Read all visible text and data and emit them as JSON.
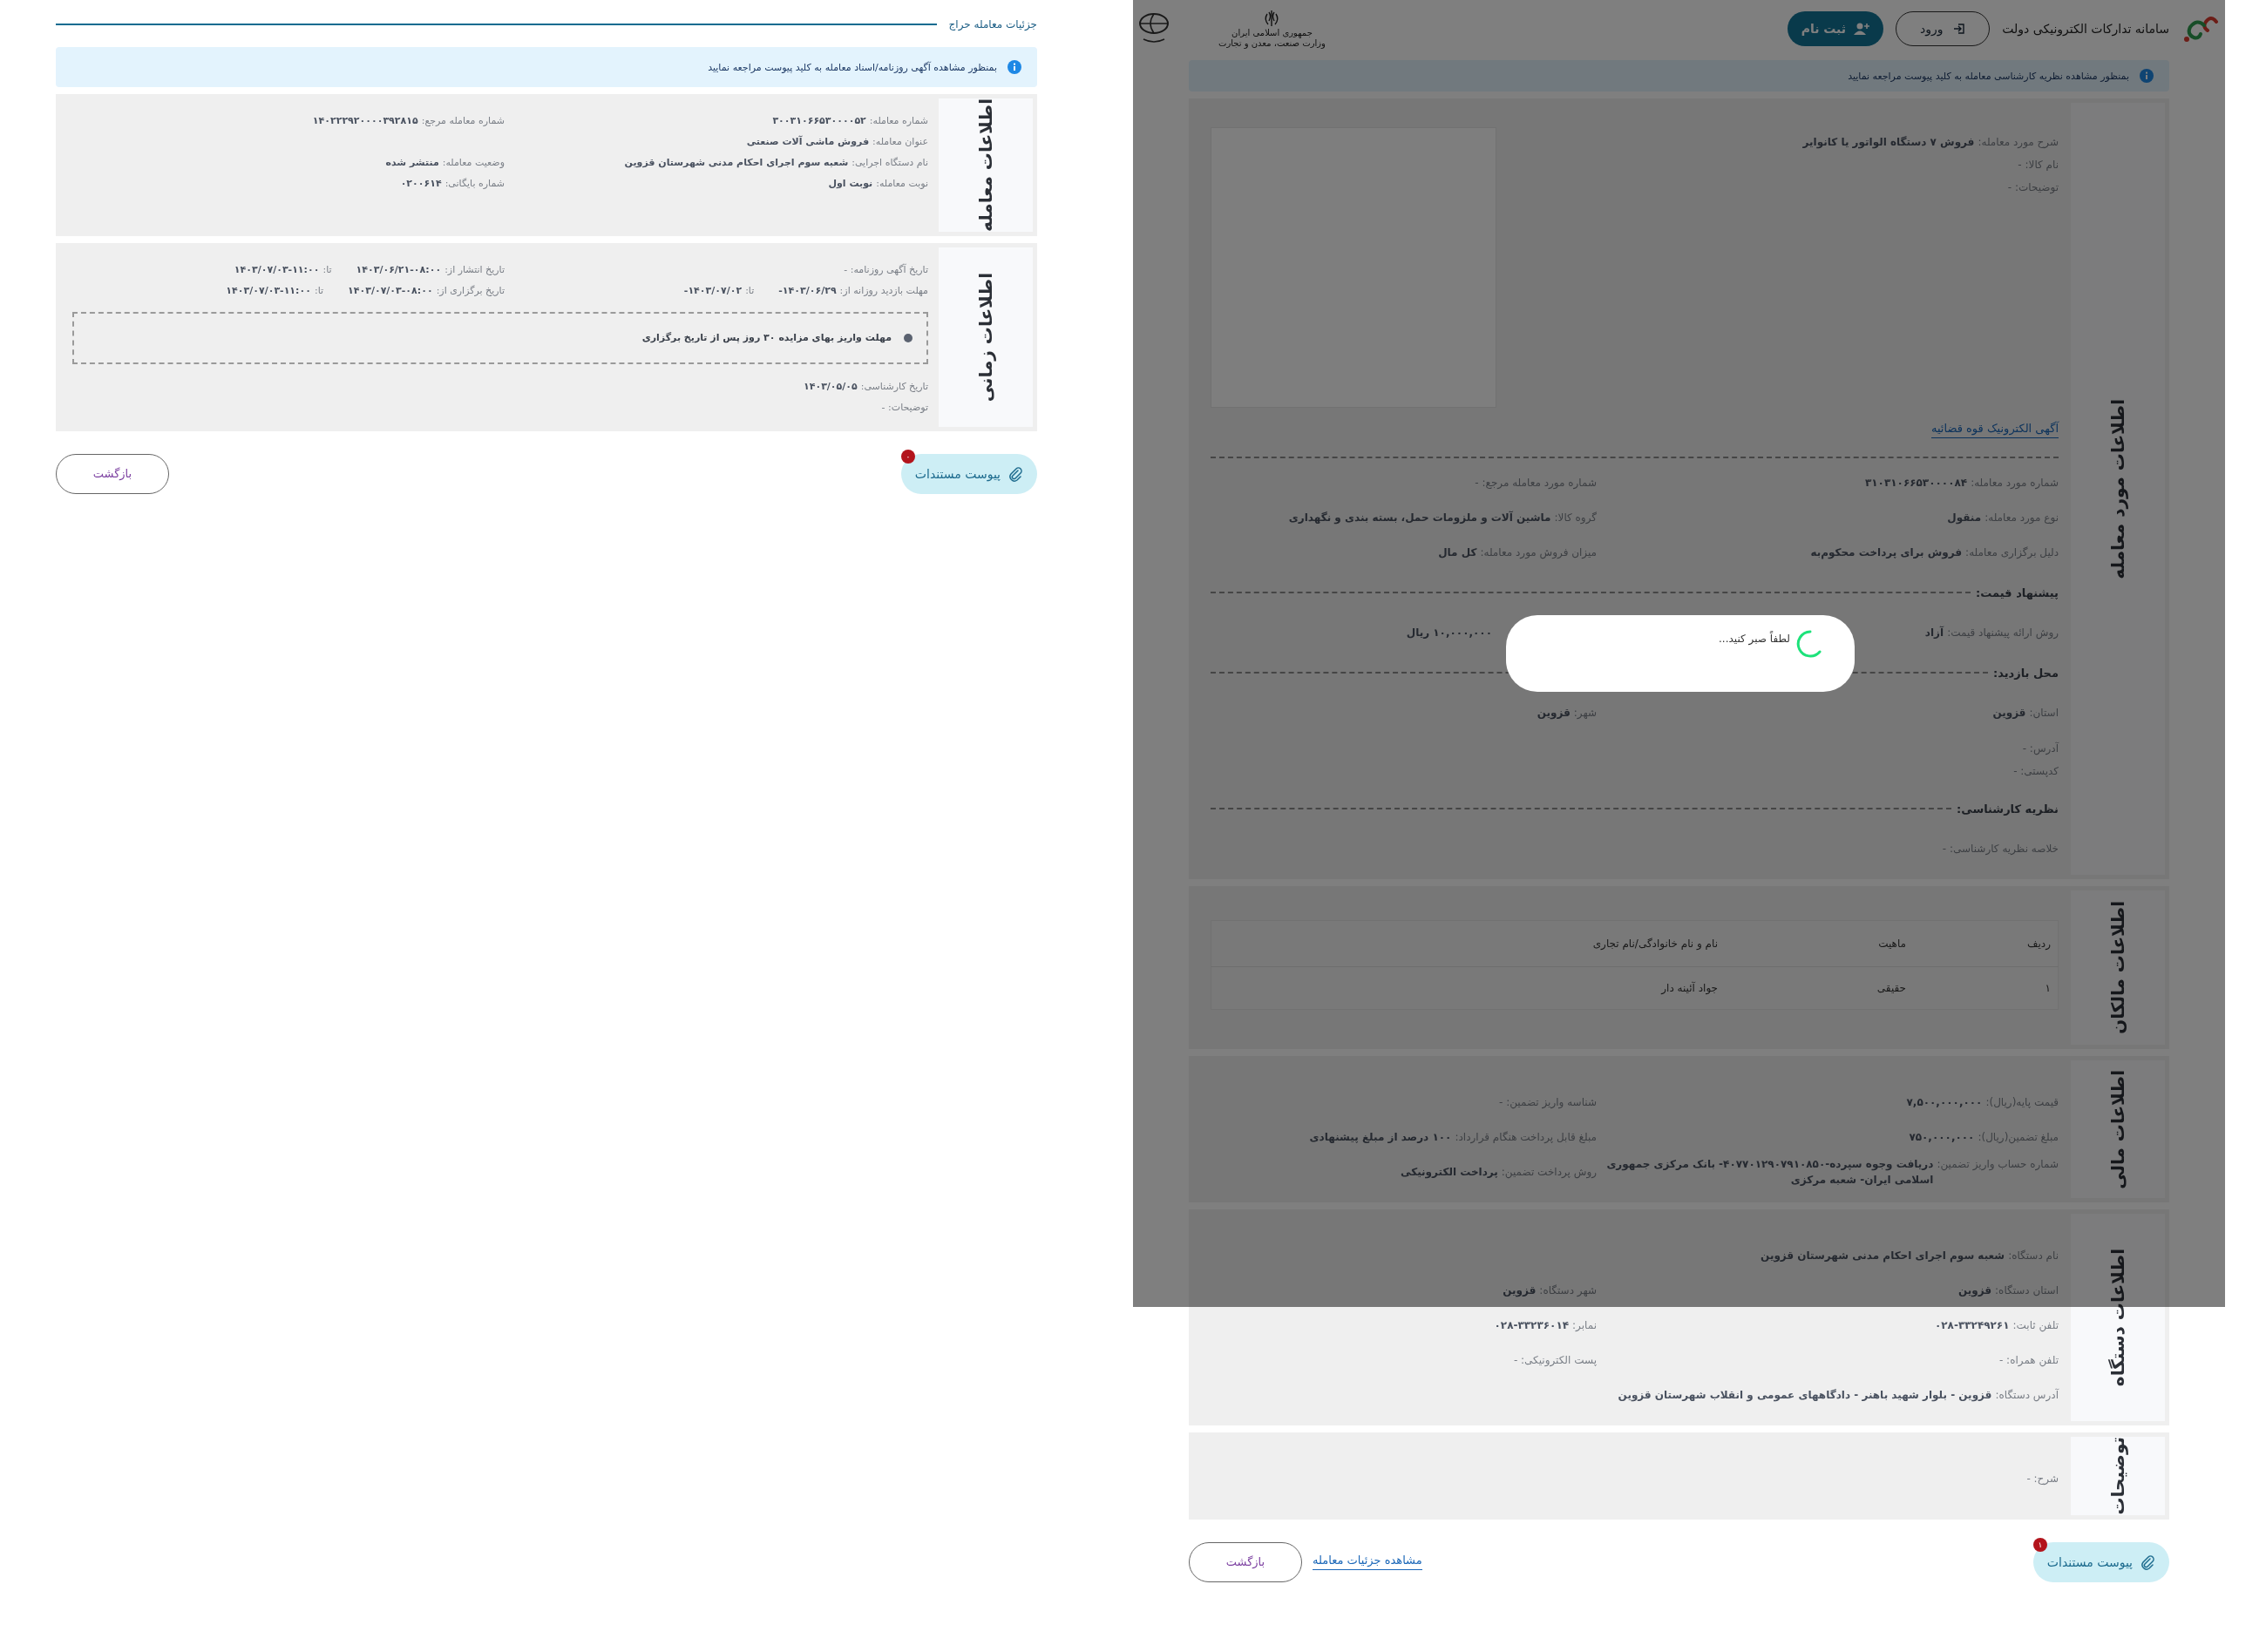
{
  "left_page": {
    "title": "جزئیات معامله حراج",
    "notice": "بمنظور مشاهده آگهی روزنامه/اسناد معامله به کلید پیوست مراجعه نمایید",
    "sections": [
      {
        "title": "اطلاعات معامله",
        "blocks": [
          {
            "kind": "fields",
            "rows": [
              [
                {
                  "label": "شماره معامله:",
                  "value": "۳۰۰۳۱۰۶۶۵۳۰۰۰۰۵۲"
                },
                {
                  "label": "شماره معامله مرجع:",
                  "value": "۱۴۰۲۲۲۹۲۰۰۰۰۳۹۲۸۱۵"
                }
              ],
              [
                {
                  "label": "عنوان معامله:",
                  "value": "فروش ماشی آلات صنعتی"
                }
              ],
              [
                {
                  "label": "نام دستگاه اجرایی:",
                  "value": "شعبه سوم اجرای احکام مدنی شهرستان قزوین"
                },
                {
                  "label": "وضعیت معامله:",
                  "value": "منتشر شده"
                }
              ],
              [
                {
                  "label": "نوبت معامله:",
                  "value": "نوبت اول"
                },
                {
                  "label": "شماره بایگانی:",
                  "value": "۰۲۰۰۶۱۴"
                }
              ]
            ]
          }
        ]
      },
      {
        "title": "اطلاعات زمانی",
        "blocks": [
          {
            "kind": "fields",
            "rows": [
              [
                {
                  "label": "تاریخ آگهی روزنامه: -"
                },
                {
                  "label": "تاریخ انتشار از:",
                  "value": "۱۴۰۳/۰۶/۲۱-۰۸:۰۰",
                  "to_label": "تا:",
                  "to_value": "۱۴۰۳/۰۷/۰۳-۱۱:۰۰"
                }
              ],
              [
                {
                  "label": "مهلت بازدید روزانه از:",
                  "value": "۱۴۰۳/۰۶/۲۹-",
                  "to_label": "تا:",
                  "to_value": "۱۴۰۳/۰۷/۰۲-"
                },
                {
                  "label": "تاریخ برگزاری از:",
                  "value": "۱۴۰۳/۰۷/۰۳-۰۸:۰۰",
                  "to_label": "تا:",
                  "to_value": "۱۴۰۳/۰۷/۰۳-۱۱:۰۰"
                }
              ]
            ]
          },
          {
            "kind": "note",
            "text": "مهلت واریز بهای مزایده ۳۰ روز پس از تاریخ برگزاری"
          },
          {
            "kind": "fields",
            "rows": [
              [
                {
                  "label": "تاریخ کارشناسی:",
                  "value": "۱۴۰۳/۰۵/۰۵"
                }
              ],
              [
                {
                  "label": "توضیحات: -"
                }
              ]
            ]
          }
        ]
      }
    ],
    "actions": {
      "attach": {
        "label": "پیوست مستندات",
        "badge": "۰"
      },
      "back": "بازگشت"
    }
  },
  "right_page": {
    "header": {
      "site_title": "سامانه تدارکات الکترونیکی دولت",
      "login": "ورود",
      "register": "ثبت نام",
      "emblem_lines": [
        "جمهوری اسلامی ایران",
        "وزارت صنعت، معدن و تجارت"
      ]
    },
    "notice": "بمنظور مشاهده نظریه کارشناسی معامله به کلید پیوست مراجعه نمایید",
    "sections": [
      {
        "title": "اطلاعات مورد معامله",
        "blocks": [
          {
            "kind": "media",
            "rows": [
              [
                {
                  "label": "شرح مورد معامله:",
                  "value": "فروش ۷ دستگاه الواتور یا کانوایر"
                }
              ],
              [
                {
                  "label": "نام کالا: -"
                }
              ],
              [
                {
                  "label": "توضیحات: -"
                }
              ]
            ]
          },
          {
            "kind": "link",
            "text": "آگهی الکترونیک قوه قضائیه"
          },
          {
            "kind": "divider"
          },
          {
            "kind": "fields",
            "rows": [
              [
                {
                  "label": "شماره مورد معامله:",
                  "value": "۳۱۰۳۱۰۶۶۵۳۰۰۰۰۸۴"
                },
                {
                  "label": "شماره مورد معامله مرجع: -"
                }
              ],
              [
                {
                  "label": "نوع مورد معامله:",
                  "value": "منقول"
                },
                {
                  "label": "گروه کالا:",
                  "value": "ماشین آلات و ملزومات حمل، بسته بندی و نگهداری"
                }
              ],
              [
                {
                  "label": "دلیل برگزاری معامله:",
                  "value": "فروش برای پرداخت محکوم‌به"
                },
                {
                  "label": "میزان فروش مورد معامله:",
                  "value": "کل مال"
                }
              ]
            ]
          },
          {
            "kind": "heading",
            "text": "پیشنهاد قیمت:"
          },
          {
            "kind": "fields",
            "rows": [
              [
                {
                  "label": "روش ارائه پیشنهاد قیمت:",
                  "value": "آزاد"
                },
                {
                  "value": "۱۰,۰۰۰,۰۰۰ ریال"
                }
              ]
            ]
          },
          {
            "kind": "heading",
            "text": "محل بازدید:"
          },
          {
            "kind": "fields",
            "rows": [
              [
                {
                  "label": "استان:",
                  "value": "قزوین"
                },
                {
                  "label": "شهر:",
                  "value": "قزوین"
                }
              ]
            ]
          },
          {
            "kind": "compact",
            "rows": [
              [
                {
                  "label": "آدرس: -"
                }
              ],
              [
                {
                  "label": "کدپستی: -"
                }
              ]
            ]
          },
          {
            "kind": "heading",
            "text": "نظریه کارشناسی:"
          },
          {
            "kind": "fields",
            "rows": [
              [
                {
                  "label": "خلاصه نظریه کارشناسی: -"
                }
              ]
            ]
          }
        ]
      },
      {
        "title": "اطلاعات مالکان",
        "blocks": [
          {
            "kind": "table",
            "columns": [
              "ردیف",
              "ماهیت",
              "نام و نام خانوادگی/نام تجاری"
            ],
            "rows": [
              [
                "۱",
                "حقیقی",
                "جواد آئینه دار"
              ]
            ]
          }
        ]
      },
      {
        "title": "اطلاعات مالی",
        "blocks": [
          {
            "kind": "fields",
            "rows": [
              [
                {
                  "label": "قیمت پایه(ریال):",
                  "value": "۷,۵۰۰,۰۰۰,۰۰۰"
                },
                {
                  "label": "شناسه واریز تضمین: -"
                }
              ],
              [
                {
                  "label": "مبلغ تضمین(ریال):",
                  "value": "۷۵۰,۰۰۰,۰۰۰"
                },
                {
                  "label": "مبلغ قابل پرداخت هنگام قرارداد:",
                  "value": "۱۰۰ درصد از مبلغ پیشنهادی"
                }
              ],
              [
                {
                  "label": "شماره حساب واریز تضمین:",
                  "value": "دریافت وجوه سپرده-۴۰۷۷۰۱۲۹۰۷۹۱۰۸۵۰- بانک مرکزی جمهوری اسلامی ایران- شعبه مرکزی"
                },
                {
                  "label": "روش پرداخت تضمین:",
                  "value": "پرداخت الکترونیکی"
                }
              ]
            ]
          }
        ]
      },
      {
        "title": "اطلاعات دستگاه",
        "blocks": [
          {
            "kind": "fields",
            "rows": [
              [
                {
                  "label": "نام دستگاه:",
                  "value": "شعبه سوم اجرای احکام مدنی شهرستان قزوین"
                }
              ],
              [
                {
                  "label": "استان دستگاه:",
                  "value": "قزوین"
                },
                {
                  "label": "شهر دستگاه:",
                  "value": "قزوین"
                }
              ],
              [
                {
                  "label": "تلفن ثابت:",
                  "value": "۰۲۸-۳۳۲۴۹۲۶۱"
                },
                {
                  "label": "نمابر:",
                  "value": "۰۲۸-۳۳۲۳۶۰۱۴"
                }
              ],
              [
                {
                  "label": "تلفن همراه: -"
                },
                {
                  "label": "پست الکترونیکی: -"
                }
              ],
              [
                {
                  "label": "آدرس دستگاه:",
                  "value": "قزوین - بلوار شهید باهنر - دادگاههای عمومی و انقلاب شهرستان قزوین"
                }
              ]
            ]
          }
        ]
      },
      {
        "title": "توضیحات",
        "blocks": [
          {
            "kind": "fields",
            "rows": [
              [
                {
                  "label": "شرح: -"
                }
              ]
            ]
          }
        ]
      }
    ],
    "actions": {
      "attach": {
        "label": "پیوست مستندات",
        "badge": "۱"
      },
      "details_link": "مشاهده جزئیات معامله",
      "back": "بازگشت"
    },
    "loading_dialog": {
      "message": "لطفاً صبر کنید..."
    }
  }
}
